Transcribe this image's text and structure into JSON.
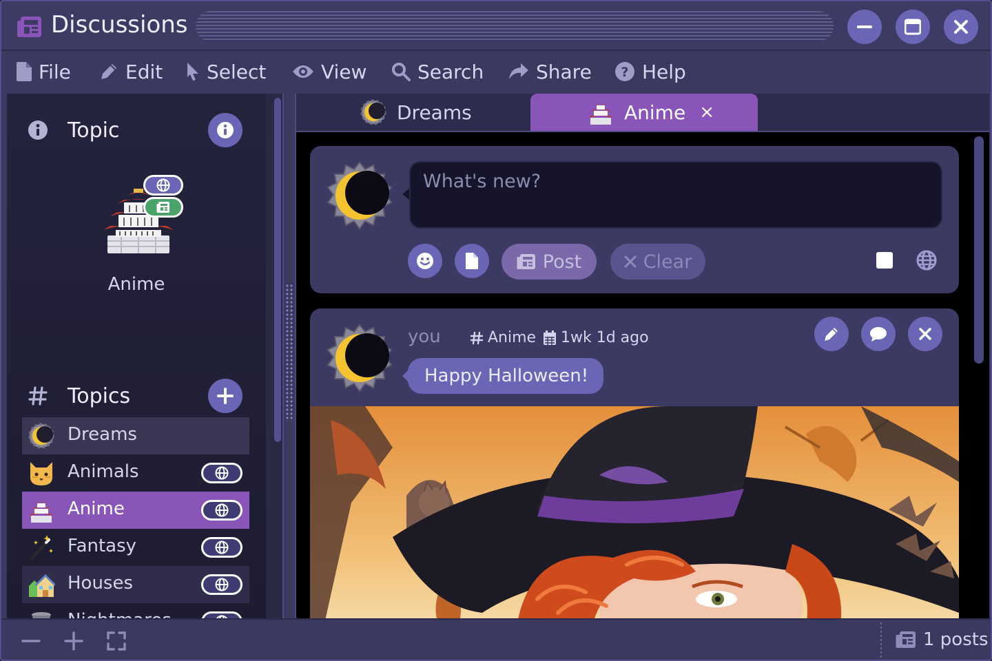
{
  "window": {
    "title": "Discussions",
    "icon": "newspaper-icon",
    "controls": [
      "minimize",
      "maximize",
      "close"
    ]
  },
  "menu": {
    "items": [
      {
        "label": "File",
        "icon": "file-icon"
      },
      {
        "label": "Edit",
        "icon": "pencil-icon"
      },
      {
        "label": "Select",
        "icon": "pointer-icon"
      },
      {
        "label": "View",
        "icon": "eye-icon"
      },
      {
        "label": "Search",
        "icon": "magnifier-icon"
      },
      {
        "label": "Share",
        "icon": "share-arrow-icon"
      },
      {
        "label": "Help",
        "icon": "question-icon"
      }
    ]
  },
  "sidebar": {
    "topic_heading": "Topic",
    "current_topic": {
      "name": "Anime",
      "emoji": "🏯",
      "badges": [
        "globe-icon",
        "newspaper-icon"
      ]
    },
    "topics_heading": "Topics",
    "topics": [
      {
        "label": "Dreams",
        "emoji": "🌜",
        "public": false,
        "state": "hovered"
      },
      {
        "label": "Animals",
        "emoji": "🐱",
        "public": true,
        "state": "normal"
      },
      {
        "label": "Anime",
        "emoji": "🏯",
        "public": true,
        "state": "selected"
      },
      {
        "label": "Fantasy",
        "emoji": "🪄",
        "public": true,
        "state": "normal"
      },
      {
        "label": "Houses",
        "emoji": "🏡",
        "public": true,
        "state": "hovered"
      },
      {
        "label": "Nightmares",
        "emoji": "🗑",
        "public": true,
        "state": "normal"
      }
    ]
  },
  "tabs": [
    {
      "label": "Dreams",
      "active": false
    },
    {
      "label": "Anime",
      "active": true,
      "close": "×"
    }
  ],
  "compose": {
    "placeholder": "What's new?",
    "post_label": "Post",
    "clear_label": "Clear"
  },
  "post": {
    "author": "you",
    "topic": "Anime",
    "time": "1wk 1d ago",
    "message": "Happy Halloween!"
  },
  "status": {
    "count_label": "1 posts"
  },
  "colors": {
    "accent": "#6a66b5",
    "selected": "#8a55b8",
    "card": "#3c3a63",
    "frame": "#3b3960"
  }
}
